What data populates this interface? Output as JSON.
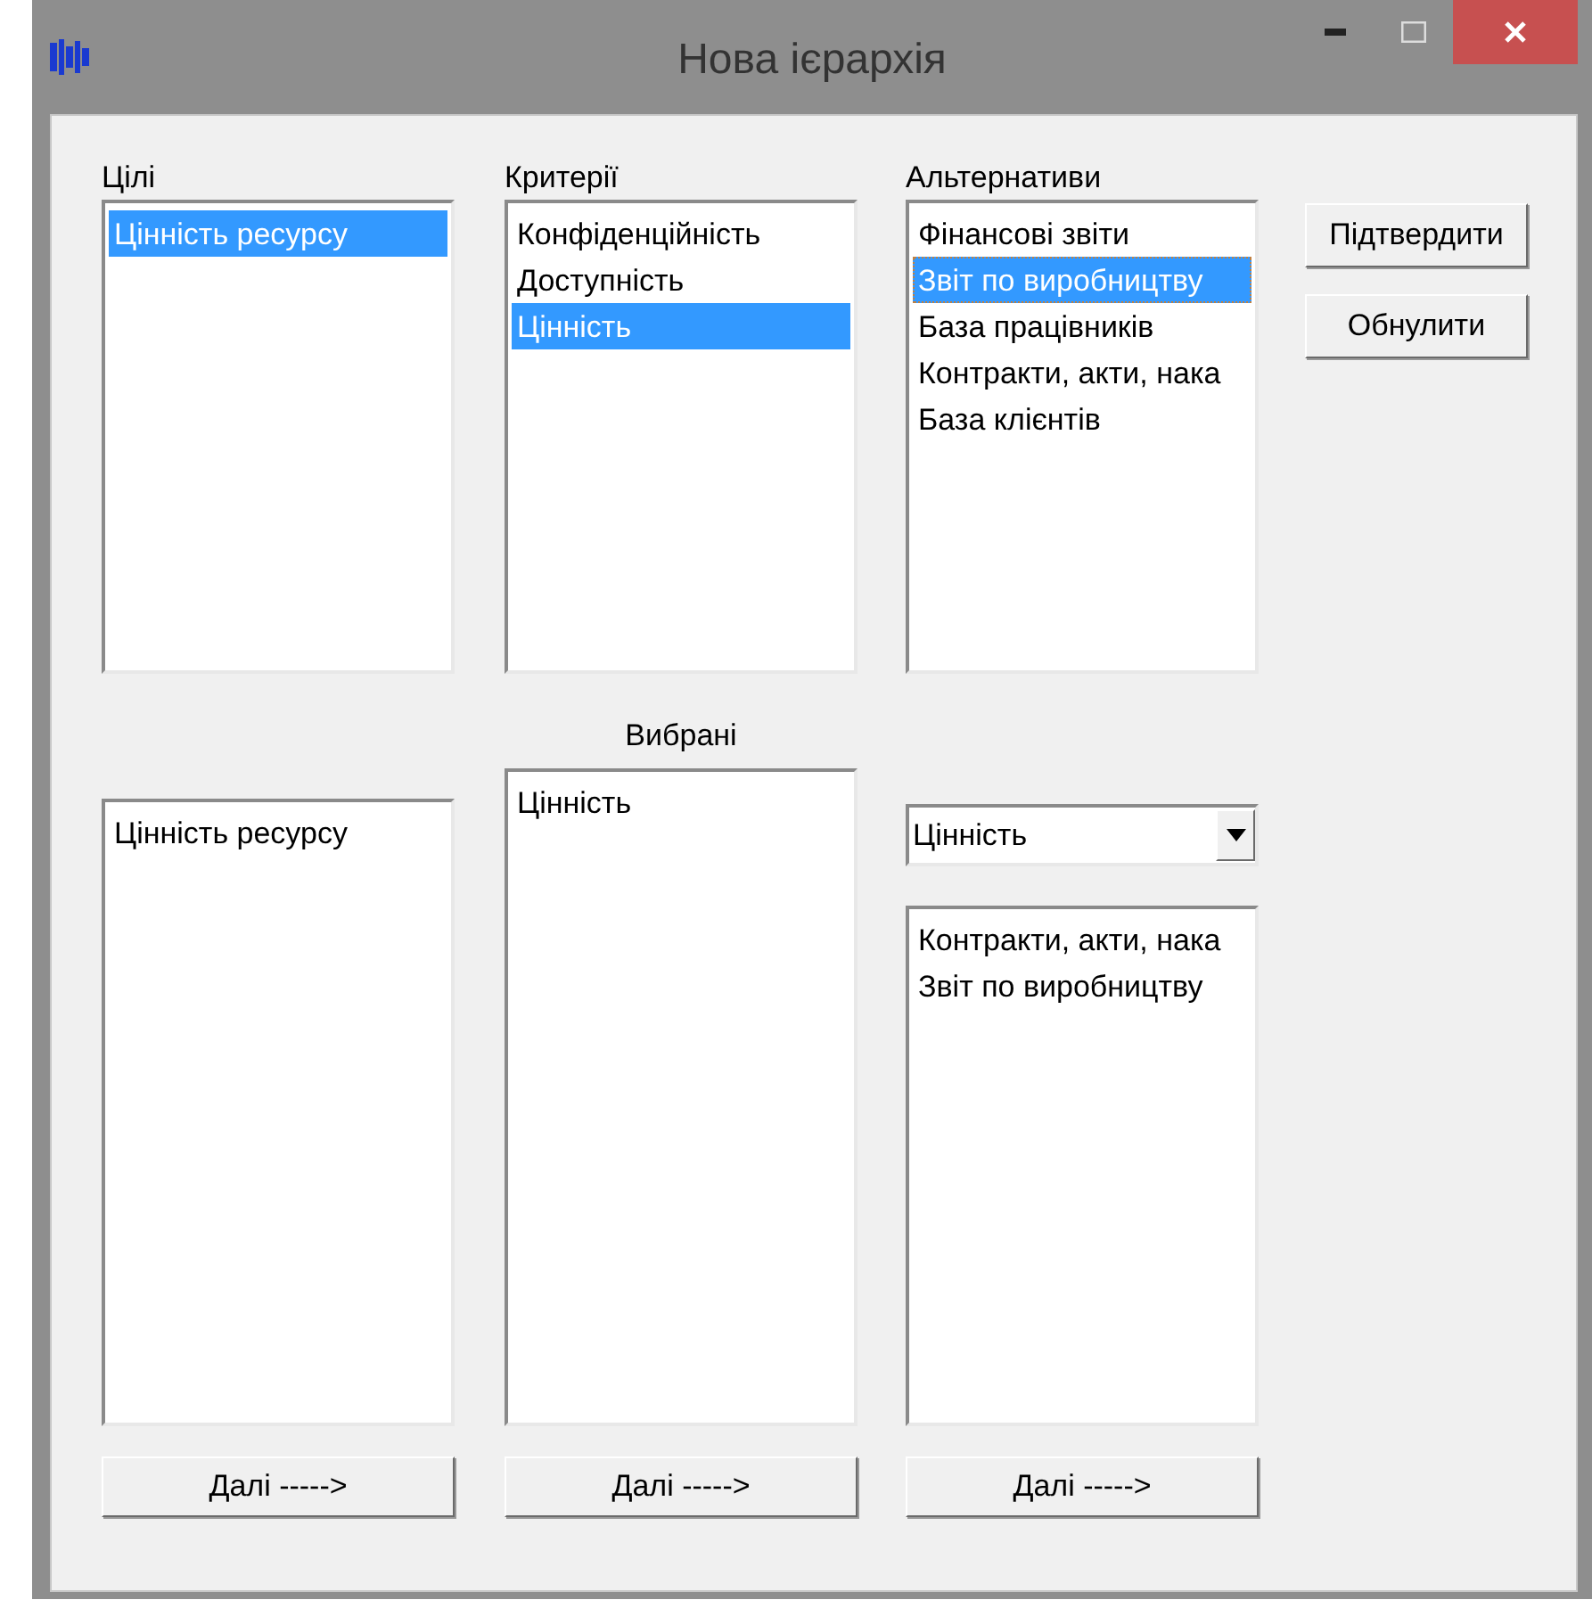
{
  "window": {
    "title": "Нова ієрархія"
  },
  "goals": {
    "label": "Цілі",
    "items": [
      {
        "text": "Цінність ресурсу",
        "selected": true
      }
    ]
  },
  "criteria": {
    "label": "Критерії",
    "items": [
      {
        "text": "Конфіденційність",
        "selected": false
      },
      {
        "text": "Доступність",
        "selected": false
      },
      {
        "text": "Цінність",
        "selected": true
      }
    ]
  },
  "alternatives": {
    "label": "Альтернативи",
    "items": [
      {
        "text": "Фінансові звіти",
        "selected": false,
        "focused": false
      },
      {
        "text": "Звіт по виробництву",
        "selected": true,
        "focused": true
      },
      {
        "text": "База працівників",
        "selected": false,
        "focused": false
      },
      {
        "text": "Контракти, акти, нака",
        "selected": false,
        "focused": false
      },
      {
        "text": "База клієнтів",
        "selected": false,
        "focused": false
      }
    ]
  },
  "side_buttons": [
    "Підтвердити",
    "Обнулити"
  ],
  "chosen_label": "Вибрані",
  "chosen_goals": [
    "Цінність ресурсу"
  ],
  "chosen_criteria": [
    "Цінність"
  ],
  "criterion_dropdown": {
    "value": "Цінність"
  },
  "chosen_alternatives": [
    "Контракти, акти, нака",
    "Звіт по виробництву"
  ],
  "next_buttons": [
    "Далі ----->",
    "Далі ----->",
    "Далі ----->"
  ]
}
